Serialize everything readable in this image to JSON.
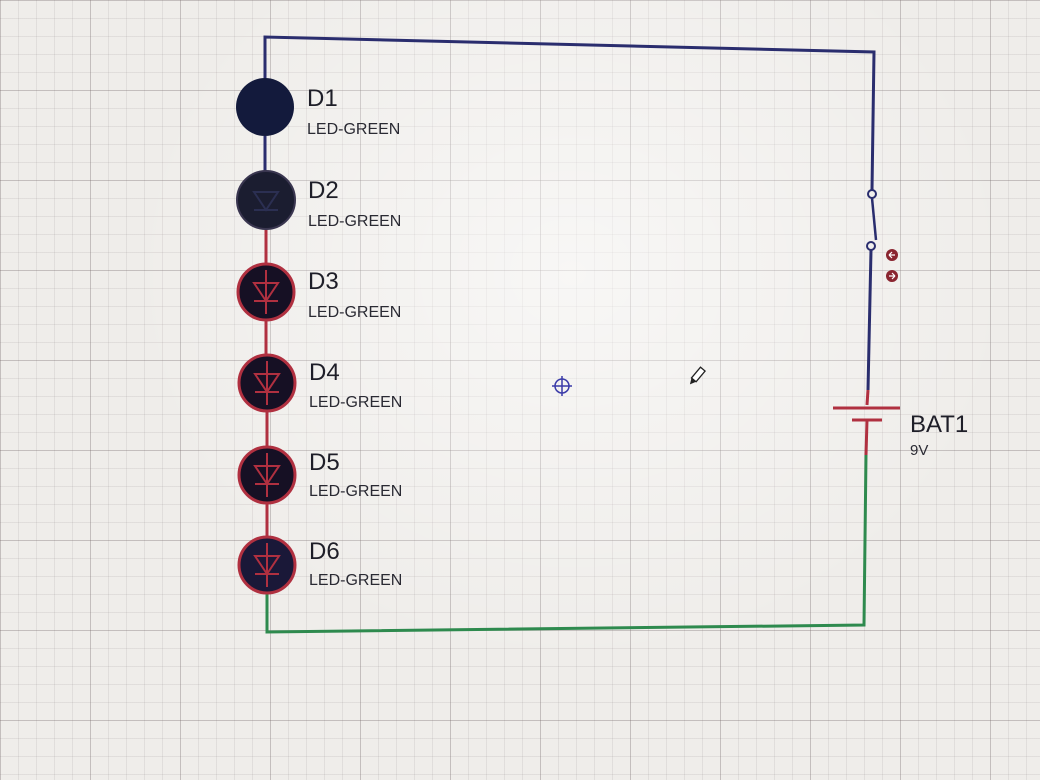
{
  "schematic": {
    "leds": [
      {
        "ref": "D1",
        "value": "LED-GREEN"
      },
      {
        "ref": "D2",
        "value": "LED-GREEN"
      },
      {
        "ref": "D3",
        "value": "LED-GREEN"
      },
      {
        "ref": "D4",
        "value": "LED-GREEN"
      },
      {
        "ref": "D5",
        "value": "LED-GREEN"
      },
      {
        "ref": "D6",
        "value": "LED-GREEN"
      }
    ],
    "battery": {
      "ref": "BAT1",
      "value": "9V"
    }
  },
  "colors": {
    "wire_high": "#2a2d6e",
    "wire_mid": "#b03040",
    "wire_low": "#2e8a4e",
    "led_body": "#141a33"
  },
  "icons": [
    "crosshair-cursor-icon",
    "pencil-icon"
  ]
}
